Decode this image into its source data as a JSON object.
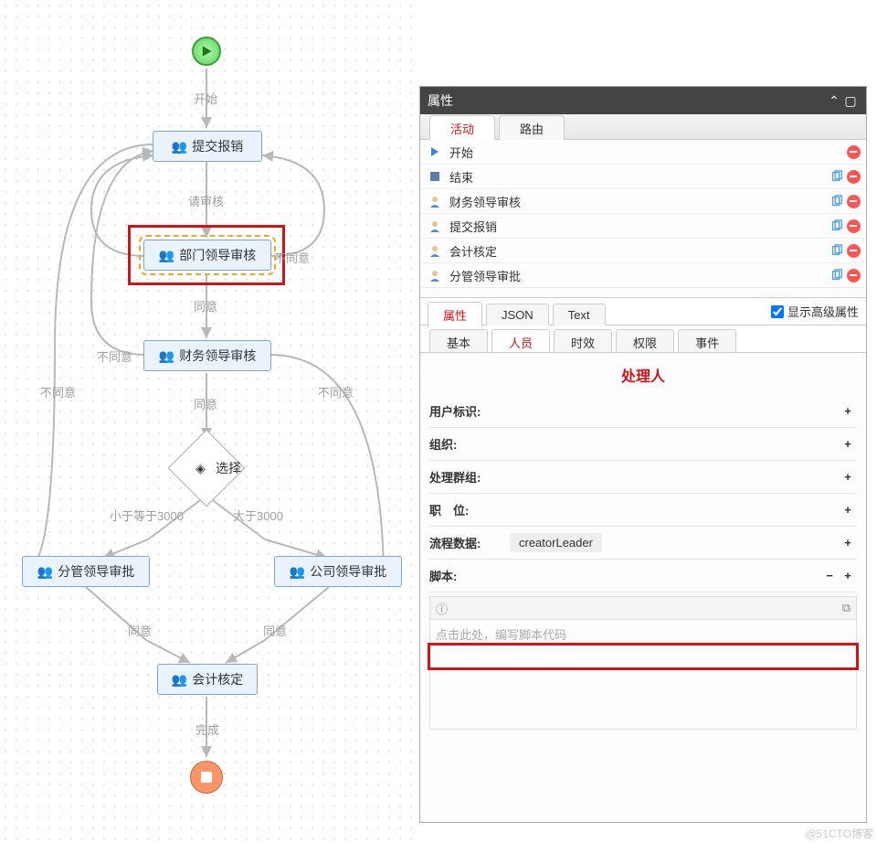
{
  "flow": {
    "start_label": "开始",
    "nodes": {
      "submit": "提交报销",
      "dept": "部门领导审核",
      "finance": "财务领导审核",
      "choice": "选择",
      "branch_left": "分管领导审批",
      "branch_right": "公司领导审批",
      "account": "会计核定"
    },
    "edges": {
      "e1": "开始",
      "e2": "请审核",
      "e3": "不同意",
      "e4": "同意",
      "e5": "不同意",
      "e6": "同意",
      "e_lt": "小于等于3000",
      "e_gt": "大于3000",
      "e_la": "同意",
      "e_ra": "同意",
      "e_lno": "不同意",
      "e_rno": "不同意",
      "e_done": "完成"
    }
  },
  "panel": {
    "title": "属性",
    "tabs1": [
      "活动",
      "路由"
    ],
    "activities": [
      {
        "icon": "play",
        "name": "开始",
        "copy": false,
        "del": true
      },
      {
        "icon": "stop",
        "name": "结束",
        "copy": true,
        "del": true
      },
      {
        "icon": "user",
        "name": "财务领导审核",
        "copy": true,
        "del": true
      },
      {
        "icon": "user",
        "name": "提交报销",
        "copy": true,
        "del": true
      },
      {
        "icon": "user",
        "name": "会计核定",
        "copy": true,
        "del": true
      },
      {
        "icon": "user",
        "name": "分管领导审批",
        "copy": true,
        "del": true
      }
    ],
    "tabs2": [
      "属性",
      "JSON",
      "Text"
    ],
    "adv_label": "显示高级属性",
    "adv_checked": true,
    "tabs3": [
      "基本",
      "人员",
      "时效",
      "权限",
      "事件"
    ],
    "tabs3_active": 1,
    "section": "处理人",
    "rows": [
      {
        "key": "用户标识:",
        "value": "",
        "plus": true,
        "minus": false
      },
      {
        "key": "组织:",
        "value": "",
        "plus": true,
        "minus": false
      },
      {
        "key": "处理群组:",
        "value": "",
        "plus": true,
        "minus": false
      },
      {
        "key": "职　位:",
        "value": "",
        "plus": true,
        "minus": false
      },
      {
        "key": "流程数据:",
        "value": "creatorLeader",
        "plus": true,
        "minus": false,
        "hi": true
      },
      {
        "key": "脚本:",
        "value": "",
        "plus": true,
        "minus": true
      }
    ],
    "script_placeholder": "点击此处，编写脚本代码"
  },
  "watermark": "@51CTO博客"
}
